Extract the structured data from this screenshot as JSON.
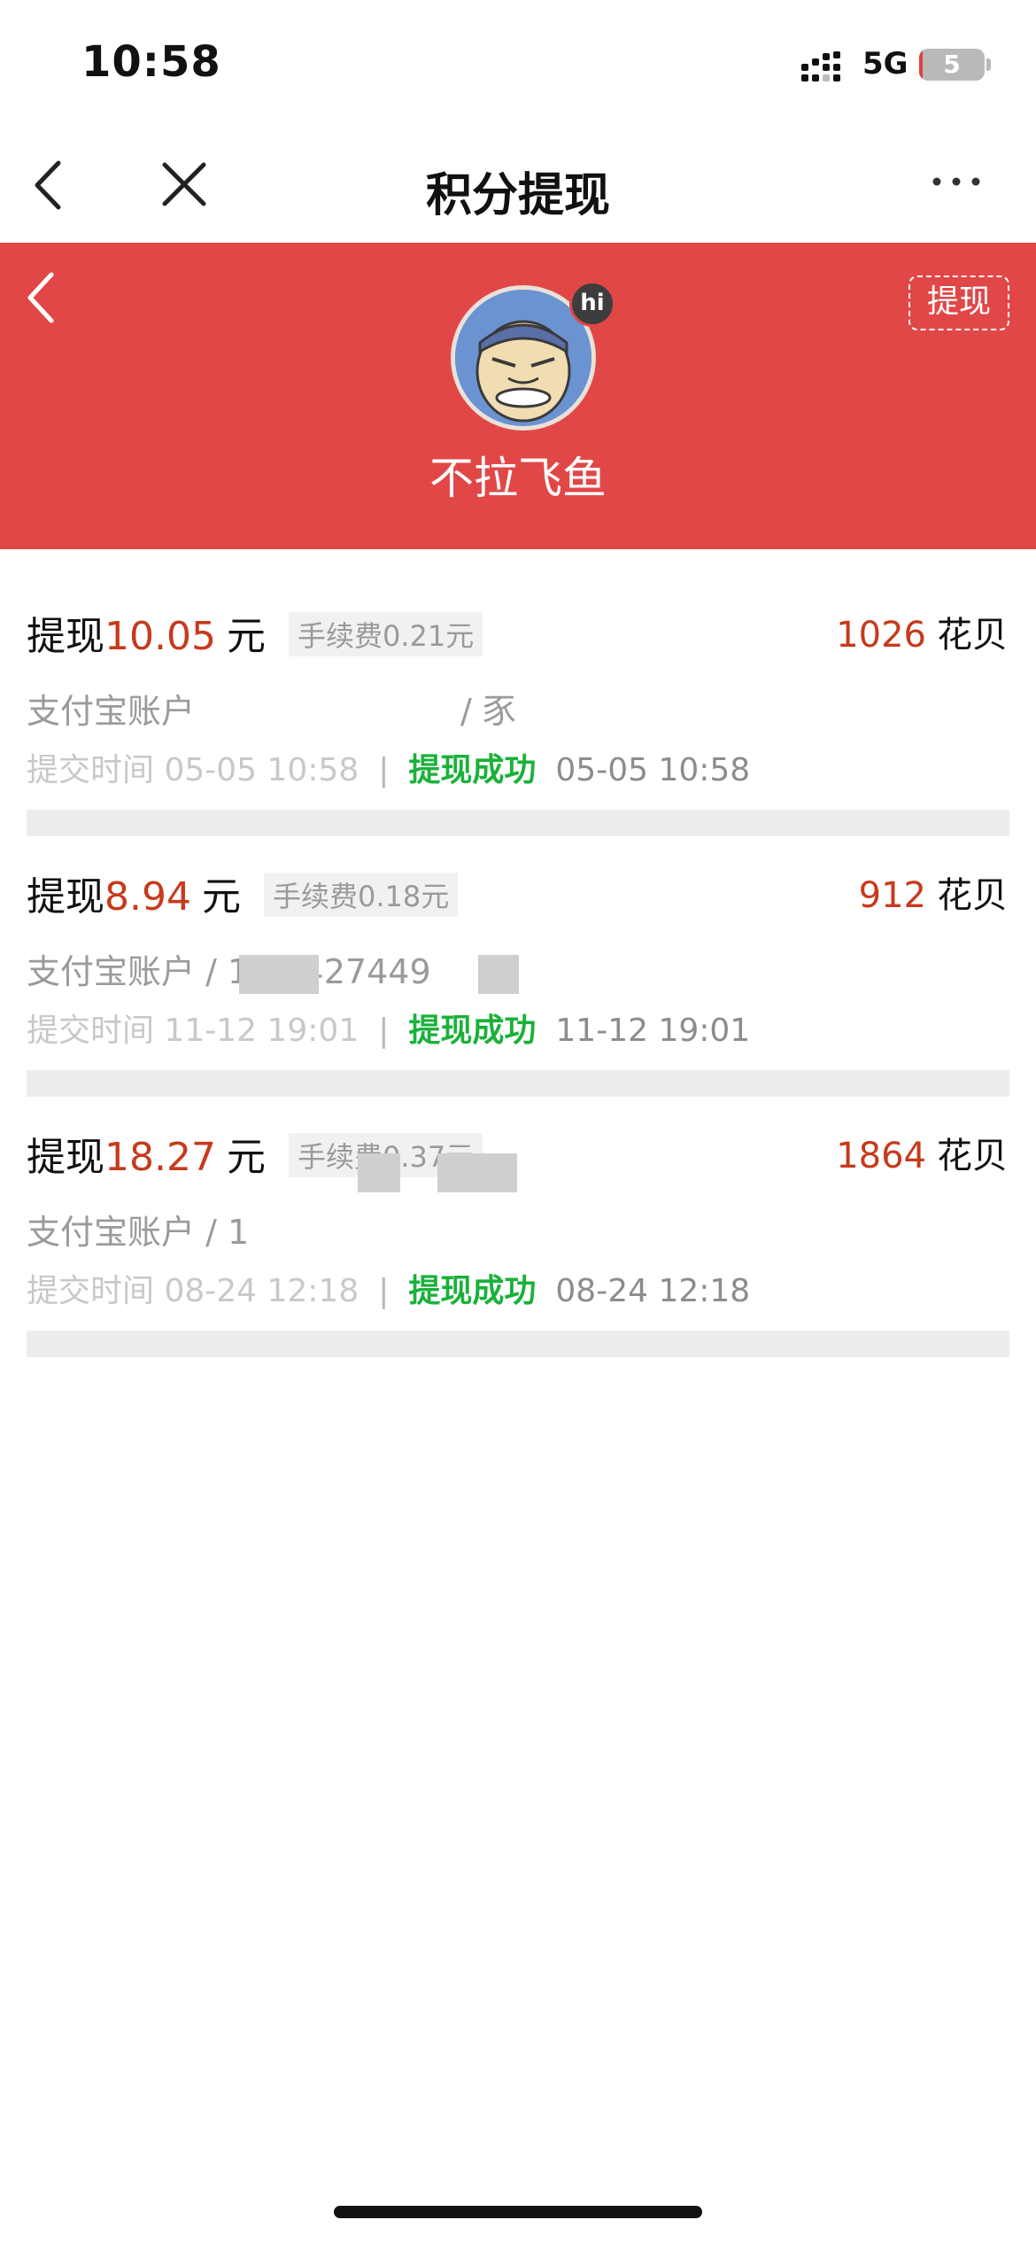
{
  "status_bar": {
    "time": "10:58",
    "network": "5G",
    "battery": "5",
    "battery_fraction": 0.05
  },
  "navbar": {
    "title": "积分提现",
    "back_icon": "chevron-left-icon",
    "close_icon": "close-icon",
    "more_icon": "more-horizontal-icon"
  },
  "header": {
    "username": "不拉飞鱼",
    "withdraw_label": "提现",
    "badge": "hi",
    "accent_color": "#e24747"
  },
  "records": [
    {
      "prefix": "提现",
      "amount": "10.05",
      "unit": "元",
      "fee": "手续费0.21元",
      "points": "1026",
      "points_unit": "花贝",
      "account": "支付宝账户",
      "account_tail": "/ 豕",
      "submit": "提交时间 05-05 10:58",
      "status": "提现成功",
      "done_time": "05-05 10:58"
    },
    {
      "prefix": "提现",
      "amount": "8.94",
      "unit": "元",
      "fee": "手续费0.18元",
      "points": "912",
      "points_unit": "花贝",
      "account": "支付宝账户 / 134   427449",
      "account_tail": "",
      "submit": "提交时间 11-12 19:01",
      "status": "提现成功",
      "done_time": "11-12 19:01"
    },
    {
      "prefix": "提现",
      "amount": "18.27",
      "unit": "元",
      "fee": "手续费0.37元",
      "points": "1864",
      "points_unit": "花贝",
      "account": "支付宝账户 / 1",
      "account_tail": "",
      "submit": "提交时间 08-24 12:18",
      "status": "提现成功",
      "done_time": "08-24 12:18"
    }
  ],
  "colors": {
    "amount": "#c63a1c",
    "success": "#1ab13a"
  }
}
